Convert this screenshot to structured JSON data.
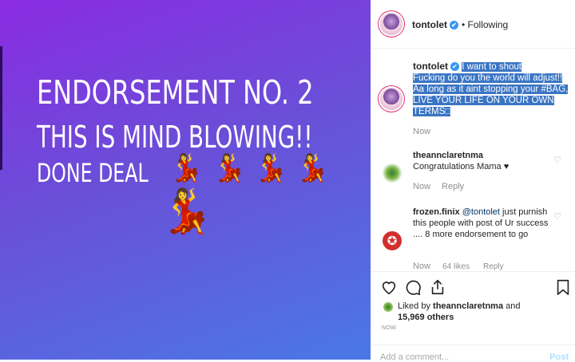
{
  "image": {
    "line1": "ENDORSEMENT NO. 2",
    "line2": "THIS IS MIND BLOWING!!",
    "line3": "DONE DEAL",
    "dancer_emoji": "💃"
  },
  "header": {
    "username": "tontolet",
    "verified_mark": "✔",
    "follow_state": "• Following"
  },
  "caption": {
    "username": "tontolet",
    "text_lines": [
      "I want to shout",
      "Fucking do you the world will adjust!!",
      "Aa long as it aint stopping your #BAG,",
      "LIVE YOUR LIFE ON YOUR OWN",
      "TERMS□"
    ],
    "time": "Now"
  },
  "comments": [
    {
      "username": "theannclaretnma",
      "text": "Congratulations Mama ♥",
      "time": "Now",
      "reply": "Reply",
      "likes": ""
    },
    {
      "username": "frozen.finix",
      "mention": "@tontolet",
      "text": " just purnish this people with post of Ur success .... 8 more endorsement to go",
      "time": "Now",
      "likes": "64 likes",
      "reply": "Reply"
    }
  ],
  "likes": {
    "prefix": "Liked by ",
    "user": "theannclaretnma",
    "and": " and",
    "count": "15,969 others"
  },
  "timestamp": "NOW",
  "add_comment": {
    "placeholder": "Add a comment...",
    "post": "Post"
  },
  "icons": {
    "heart": "heart-icon",
    "comment": "comment-icon",
    "share": "share-icon",
    "save": "bookmark-icon"
  }
}
